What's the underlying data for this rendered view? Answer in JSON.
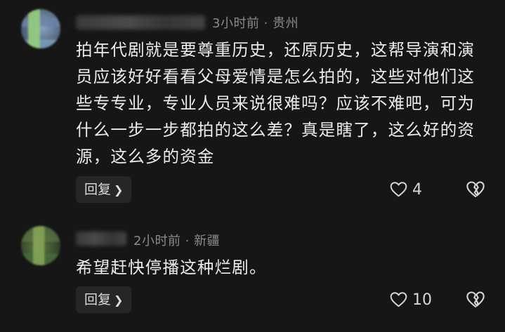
{
  "comments": [
    {
      "meta": "3小时前 · 贵州",
      "text": "拍年代剧就是要尊重历史，还原历史，这帮导演和演员应该好好看看父母爱情是怎么拍的，这些对他们这些专专业，专业人员来说很难吗？应该不难吧，可为什么一步一步都拍的这么差？真是瞎了，这么好的资源，这么多的资金",
      "reply_label": "回复",
      "like_count": "4"
    },
    {
      "meta": "2小时前 · 新疆",
      "text": "希望赶快停播这种烂剧。",
      "reply_label": "回复",
      "like_count": "10"
    }
  ],
  "icons": {
    "like": "heart-outline-icon",
    "dislike": "broken-heart-icon",
    "reply_chevron": "chevron-right-icon"
  },
  "colors": {
    "background": "#161616",
    "text": "#ececec",
    "meta": "#8a8a8a",
    "button_bg": "#262626"
  }
}
